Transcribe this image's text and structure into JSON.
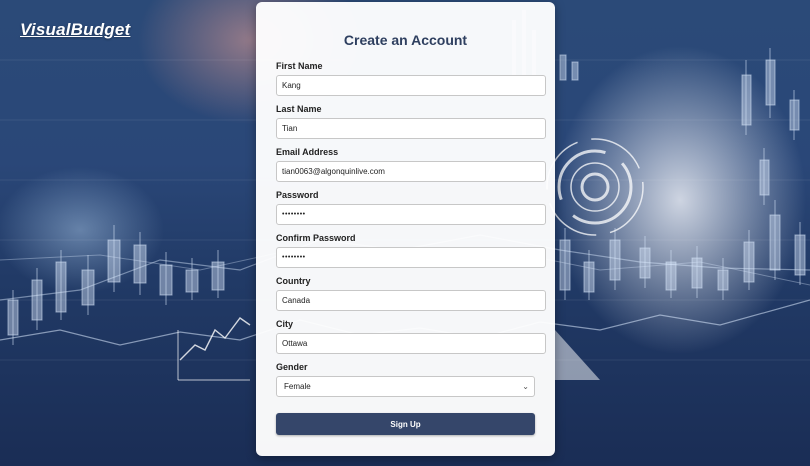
{
  "brand": "VisualBudget",
  "form": {
    "title": "Create an Account",
    "fields": [
      {
        "label": "First Name",
        "value": "Kang"
      },
      {
        "label": "Last Name",
        "value": "Tian"
      },
      {
        "label": "Email Address",
        "value": "tian0063@algonquinlive.com"
      },
      {
        "label": "Password",
        "value": "••••••••"
      },
      {
        "label": "Confirm Password",
        "value": "••••••••"
      },
      {
        "label": "Country",
        "value": "Canada"
      },
      {
        "label": "City",
        "value": "Ottawa"
      }
    ],
    "gender": {
      "label": "Gender",
      "selected": "Female"
    },
    "submit_label": "Sign Up"
  },
  "colors": {
    "button": "#35466a",
    "title": "#2e3f5f",
    "background": "#2a4778"
  },
  "icons": {
    "select_chevron": "chevron-down-icon"
  }
}
